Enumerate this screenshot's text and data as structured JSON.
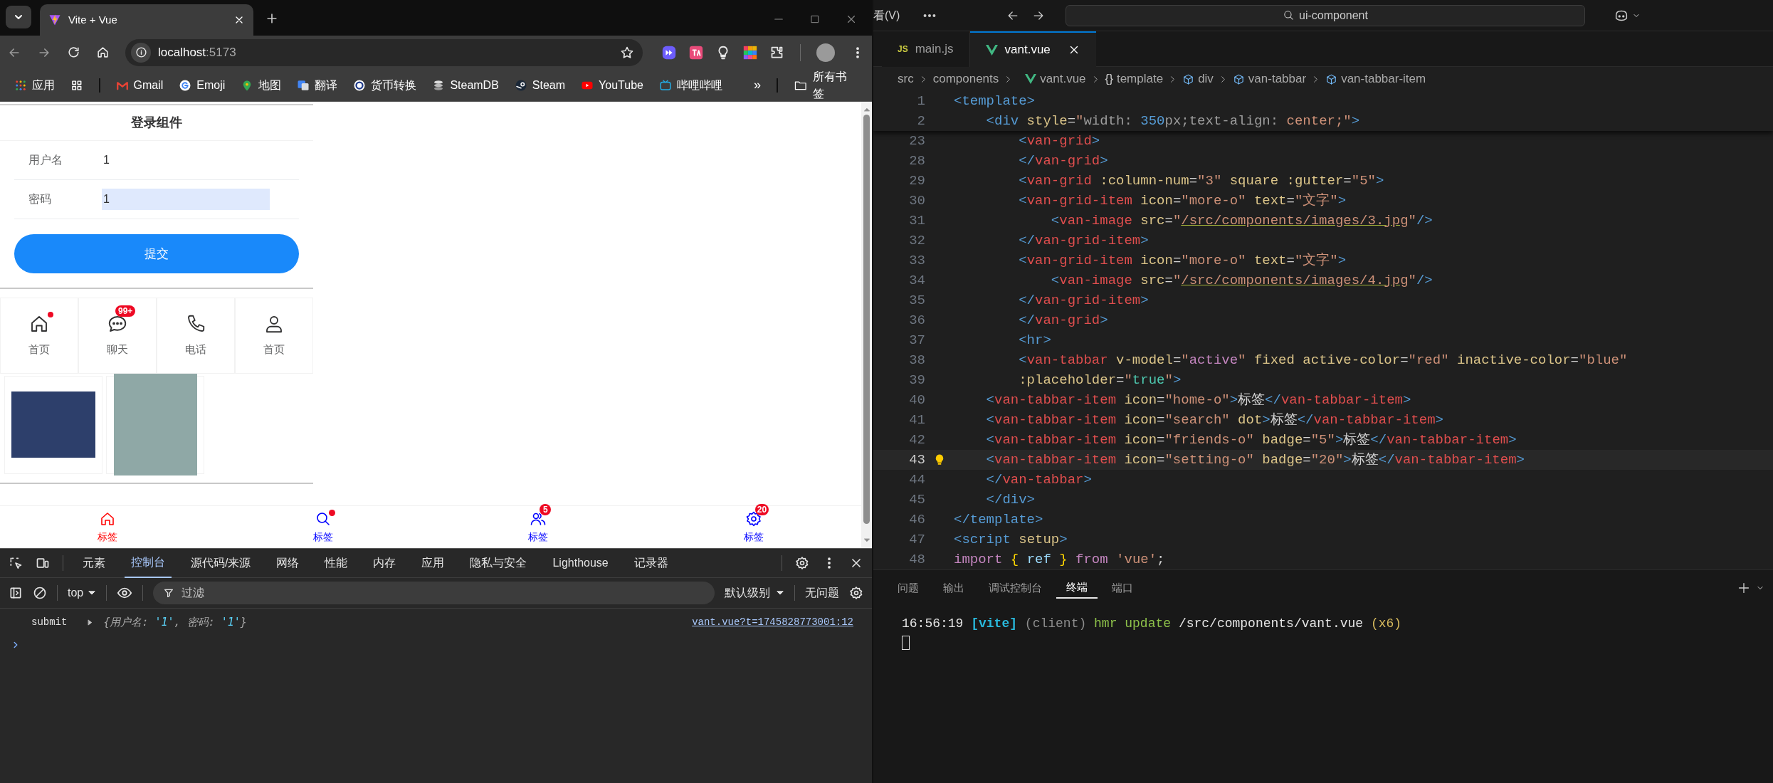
{
  "browser": {
    "tab": {
      "title": "Vite + Vue"
    },
    "address": {
      "host": "localhost",
      "port": ":5173"
    },
    "bookmarks": [
      {
        "label": "应用",
        "kind": "apps"
      },
      {
        "label": "Gmail",
        "kind": "gmail"
      },
      {
        "label": "Emoji",
        "kind": "google"
      },
      {
        "label": "地图",
        "kind": "maps"
      },
      {
        "label": "翻译",
        "kind": "translate"
      },
      {
        "label": "货币转换",
        "kind": "xe"
      },
      {
        "label": "SteamDB",
        "kind": "steamdb"
      },
      {
        "label": "Steam",
        "kind": "steam"
      },
      {
        "label": "YouTube",
        "kind": "youtube"
      },
      {
        "label": "哔哩哔哩",
        "kind": "bilibili"
      }
    ],
    "bookmarks_more": "»",
    "all_bookmarks": "所有书签"
  },
  "page": {
    "form": {
      "title": "登录组件",
      "fields": [
        {
          "label": "用户名",
          "value": "1",
          "autofilled": false
        },
        {
          "label": "密码",
          "value": "1",
          "autofilled": true
        }
      ],
      "submit": "提交"
    },
    "grid": [
      {
        "label": "首页",
        "kind": "home",
        "dot": true
      },
      {
        "label": "聊天",
        "kind": "chat",
        "dot": false,
        "badge": "99+"
      },
      {
        "label": "电话",
        "kind": "phone",
        "dot": false
      },
      {
        "label": "首页",
        "kind": "user",
        "dot": false
      }
    ],
    "images": [
      {
        "kind": "landscape"
      },
      {
        "kind": "portrait"
      }
    ],
    "tabbar": [
      {
        "label": "标签",
        "kind": "home",
        "selected": true,
        "dot": false
      },
      {
        "label": "标签",
        "kind": "search",
        "selected": false,
        "dot": true
      },
      {
        "label": "标签",
        "kind": "friends",
        "selected": false,
        "dot": false,
        "badge": "5"
      },
      {
        "label": "标签",
        "kind": "gear",
        "selected": false,
        "dot": false,
        "badge": "20"
      }
    ]
  },
  "devtools": {
    "tabs": [
      {
        "label": "元素",
        "selected": false
      },
      {
        "label": "控制台",
        "selected": true
      },
      {
        "label": "源代码/来源",
        "selected": false
      },
      {
        "label": "网络",
        "selected": false
      },
      {
        "label": "性能",
        "selected": false
      },
      {
        "label": "内存",
        "selected": false
      },
      {
        "label": "应用",
        "selected": false
      },
      {
        "label": "隐私与安全",
        "selected": false
      },
      {
        "label": "Lighthouse",
        "selected": false
      },
      {
        "label": "记录器",
        "selected": false
      }
    ],
    "console_toolbar": {
      "context": "top",
      "filter_placeholder": "过滤",
      "level": "默认级别",
      "issues": "无问题"
    },
    "log": [
      {
        "message": "submit",
        "object": [
          {
            "kind": "punct",
            "text": "{用户名: "
          },
          {
            "kind": "value",
            "text": "'1'"
          },
          {
            "kind": "punct",
            "text": ", 密码: "
          },
          {
            "kind": "value",
            "text": "'1'"
          },
          {
            "kind": "punct",
            "text": "}"
          }
        ],
        "source": "vant.vue?t=1745828773001:12"
      }
    ]
  },
  "editor": {
    "menu": "看(V)",
    "search": "ui-component",
    "tabs": [
      {
        "label": "main.js",
        "kind": "js",
        "badge": "JS",
        "selected": false
      },
      {
        "label": "vant.vue",
        "kind": "vue",
        "selected": true
      }
    ],
    "breadcrumb": [
      {
        "label": "src",
        "kind": "folder"
      },
      {
        "label": "components",
        "kind": "folder"
      },
      {
        "label": "vant.vue",
        "kind": "vue"
      },
      {
        "label": "template",
        "kind": "braces",
        "symbol": "{}"
      },
      {
        "label": "div",
        "kind": "element"
      },
      {
        "label": "van-tabbar",
        "kind": "element"
      },
      {
        "label": "van-tabbar-item",
        "kind": "element"
      }
    ],
    "sticky_lines": [
      {
        "number": "1",
        "current": false,
        "tokens": [
          {
            "kind": "tag",
            "text": "<template>"
          }
        ]
      },
      {
        "number": "2",
        "current": false,
        "tokens": [
          {
            "kind": "tag",
            "text": "    <div"
          },
          {
            "kind": "attr",
            "text": " style"
          },
          {
            "kind": "text",
            "text": "="
          },
          {
            "kind": "str",
            "text": "\""
          },
          {
            "kind": "css",
            "text": "width: "
          },
          {
            "kind": "num",
            "text": "350"
          },
          {
            "kind": "css",
            "text": "px;text-align: "
          },
          {
            "kind": "str",
            "text": "center;\""
          },
          {
            "kind": "tag",
            "text": ">"
          }
        ]
      }
    ],
    "lines": [
      {
        "number": "23",
        "current": false,
        "tokens": [
          {
            "kind": "tag",
            "text": "        <"
          },
          {
            "kind": "comp",
            "text": "van-grid"
          },
          {
            "kind": "tag",
            "text": ">"
          }
        ]
      },
      {
        "number": "28",
        "current": false,
        "tokens": [
          {
            "kind": "tag",
            "text": "        </"
          },
          {
            "kind": "comp",
            "text": "van-grid"
          },
          {
            "kind": "tag",
            "text": ">"
          }
        ]
      },
      {
        "number": "29",
        "current": false,
        "tokens": [
          {
            "kind": "tag",
            "text": "        <"
          },
          {
            "kind": "comp",
            "text": "van-grid"
          },
          {
            "kind": "attr",
            "text": " :column-num"
          },
          {
            "kind": "text",
            "text": "="
          },
          {
            "kind": "str",
            "text": "\"3\""
          },
          {
            "kind": "attr",
            "text": " square :gutter"
          },
          {
            "kind": "text",
            "text": "="
          },
          {
            "kind": "str",
            "text": "\"5\""
          },
          {
            "kind": "tag",
            "text": ">"
          }
        ]
      },
      {
        "number": "30",
        "current": false,
        "tokens": [
          {
            "kind": "tag",
            "text": "        <"
          },
          {
            "kind": "comp",
            "text": "van-grid-item"
          },
          {
            "kind": "attr",
            "text": " icon"
          },
          {
            "kind": "text",
            "text": "="
          },
          {
            "kind": "str",
            "text": "\"more-o\""
          },
          {
            "kind": "attr",
            "text": " text"
          },
          {
            "kind": "text",
            "text": "="
          },
          {
            "kind": "str",
            "text": "\"文字\""
          },
          {
            "kind": "tag",
            "text": ">"
          }
        ]
      },
      {
        "number": "31",
        "current": false,
        "tokens": [
          {
            "kind": "tag",
            "text": "            <"
          },
          {
            "kind": "comp",
            "text": "van-image"
          },
          {
            "kind": "attr",
            "text": " src"
          },
          {
            "kind": "text",
            "text": "="
          },
          {
            "kind": "str",
            "text": "\""
          },
          {
            "kind": "link",
            "text": "/src/components/images/3.jpg"
          },
          {
            "kind": "str",
            "text": "\""
          },
          {
            "kind": "tag",
            "text": "/>"
          }
        ]
      },
      {
        "number": "32",
        "current": false,
        "tokens": [
          {
            "kind": "tag",
            "text": "        </"
          },
          {
            "kind": "comp",
            "text": "van-grid-item"
          },
          {
            "kind": "tag",
            "text": ">"
          }
        ]
      },
      {
        "number": "33",
        "current": false,
        "tokens": [
          {
            "kind": "tag",
            "text": "        <"
          },
          {
            "kind": "comp",
            "text": "van-grid-item"
          },
          {
            "kind": "attr",
            "text": " icon"
          },
          {
            "kind": "text",
            "text": "="
          },
          {
            "kind": "str",
            "text": "\"more-o\""
          },
          {
            "kind": "attr",
            "text": " text"
          },
          {
            "kind": "text",
            "text": "="
          },
          {
            "kind": "str",
            "text": "\"文字\""
          },
          {
            "kind": "tag",
            "text": ">"
          }
        ]
      },
      {
        "number": "34",
        "current": false,
        "tokens": [
          {
            "kind": "tag",
            "text": "            <"
          },
          {
            "kind": "comp",
            "text": "van-image"
          },
          {
            "kind": "attr",
            "text": " src"
          },
          {
            "kind": "text",
            "text": "="
          },
          {
            "kind": "str",
            "text": "\""
          },
          {
            "kind": "link",
            "text": "/src/components/images/4.jpg"
          },
          {
            "kind": "str",
            "text": "\""
          },
          {
            "kind": "tag",
            "text": "/>"
          }
        ]
      },
      {
        "number": "35",
        "current": false,
        "tokens": [
          {
            "kind": "tag",
            "text": "        </"
          },
          {
            "kind": "comp",
            "text": "van-grid-item"
          },
          {
            "kind": "tag",
            "text": ">"
          }
        ]
      },
      {
        "number": "36",
        "current": false,
        "tokens": [
          {
            "kind": "tag",
            "text": "        </"
          },
          {
            "kind": "comp",
            "text": "van-grid"
          },
          {
            "kind": "tag",
            "text": ">"
          }
        ]
      },
      {
        "number": "37",
        "current": false,
        "tokens": [
          {
            "kind": "tag",
            "text": "        <hr>"
          }
        ]
      },
      {
        "number": "38",
        "current": false,
        "tokens": [
          {
            "kind": "tag",
            "text": "        <"
          },
          {
            "kind": "comp",
            "text": "van-tabbar"
          },
          {
            "kind": "attr",
            "text": " v-model"
          },
          {
            "kind": "text",
            "text": "="
          },
          {
            "kind": "str",
            "text": "\""
          },
          {
            "kind": "var",
            "text": "active"
          },
          {
            "kind": "str",
            "text": "\""
          },
          {
            "kind": "attr",
            "text": " fixed active-color"
          },
          {
            "kind": "text",
            "text": "="
          },
          {
            "kind": "str",
            "text": "\"red\""
          },
          {
            "kind": "attr",
            "text": " inactive-color"
          },
          {
            "kind": "text",
            "text": "="
          },
          {
            "kind": "str",
            "text": "\"blue\""
          }
        ]
      },
      {
        "number": "39",
        "current": false,
        "tokens": [
          {
            "kind": "attr",
            "text": "        :placeholder"
          },
          {
            "kind": "text",
            "text": "="
          },
          {
            "kind": "str",
            "text": "\""
          },
          {
            "kind": "const",
            "text": "true"
          },
          {
            "kind": "str",
            "text": "\""
          },
          {
            "kind": "tag",
            "text": ">"
          }
        ]
      },
      {
        "number": "40",
        "current": false,
        "tokens": [
          {
            "kind": "tag",
            "text": "    <"
          },
          {
            "kind": "comp",
            "text": "van-tabbar-item"
          },
          {
            "kind": "attr",
            "text": " icon"
          },
          {
            "kind": "text",
            "text": "="
          },
          {
            "kind": "str",
            "text": "\"home-o\""
          },
          {
            "kind": "tag",
            "text": ">"
          },
          {
            "kind": "text",
            "text": "标签"
          },
          {
            "kind": "tag",
            "text": "</"
          },
          {
            "kind": "comp",
            "text": "van-tabbar-item"
          },
          {
            "kind": "tag",
            "text": ">"
          }
        ]
      },
      {
        "number": "41",
        "current": false,
        "tokens": [
          {
            "kind": "tag",
            "text": "    <"
          },
          {
            "kind": "comp",
            "text": "van-tabbar-item"
          },
          {
            "kind": "attr",
            "text": " icon"
          },
          {
            "kind": "text",
            "text": "="
          },
          {
            "kind": "str",
            "text": "\"search\""
          },
          {
            "kind": "attr",
            "text": " dot"
          },
          {
            "kind": "tag",
            "text": ">"
          },
          {
            "kind": "text",
            "text": "标签"
          },
          {
            "kind": "tag",
            "text": "</"
          },
          {
            "kind": "comp",
            "text": "van-tabbar-item"
          },
          {
            "kind": "tag",
            "text": ">"
          }
        ]
      },
      {
        "number": "42",
        "current": false,
        "tokens": [
          {
            "kind": "tag",
            "text": "    <"
          },
          {
            "kind": "comp",
            "text": "van-tabbar-item"
          },
          {
            "kind": "attr",
            "text": " icon"
          },
          {
            "kind": "text",
            "text": "="
          },
          {
            "kind": "str",
            "text": "\"friends-o\""
          },
          {
            "kind": "attr",
            "text": " badge"
          },
          {
            "kind": "text",
            "text": "="
          },
          {
            "kind": "str",
            "text": "\"5\""
          },
          {
            "kind": "tag",
            "text": ">"
          },
          {
            "kind": "text",
            "text": "标签"
          },
          {
            "kind": "tag",
            "text": "</"
          },
          {
            "kind": "comp",
            "text": "van-tabbar-item"
          },
          {
            "kind": "tag",
            "text": ">"
          }
        ]
      },
      {
        "number": "43",
        "current": true,
        "tokens": [
          {
            "kind": "tag",
            "text": "    <"
          },
          {
            "kind": "comp",
            "text": "van-tabbar-item"
          },
          {
            "kind": "attr",
            "text": " icon"
          },
          {
            "kind": "text",
            "text": "="
          },
          {
            "kind": "str",
            "text": "\"setting-o\""
          },
          {
            "kind": "attr",
            "text": " badge"
          },
          {
            "kind": "text",
            "text": "="
          },
          {
            "kind": "str",
            "text": "\"20\""
          },
          {
            "kind": "tag",
            "text": ">"
          },
          {
            "kind": "text",
            "text": "标签"
          },
          {
            "kind": "tag",
            "text": "</"
          },
          {
            "kind": "comp",
            "text": "van-tabbar-item"
          },
          {
            "kind": "tag",
            "text": ">"
          }
        ]
      },
      {
        "number": "44",
        "current": false,
        "tokens": [
          {
            "kind": "tag",
            "text": "    </"
          },
          {
            "kind": "comp",
            "text": "van-tabbar"
          },
          {
            "kind": "tag",
            "text": ">"
          }
        ]
      },
      {
        "number": "45",
        "current": false,
        "tokens": [
          {
            "kind": "tag",
            "text": "    </div>"
          }
        ]
      },
      {
        "number": "46",
        "current": false,
        "tokens": [
          {
            "kind": "tag",
            "text": "</template>"
          }
        ]
      },
      {
        "number": "47",
        "current": false,
        "tokens": [
          {
            "kind": "tag",
            "text": "<script"
          },
          {
            "kind": "attr",
            "text": " setup"
          },
          {
            "kind": "tag",
            "text": ">"
          }
        ]
      },
      {
        "number": "48",
        "current": false,
        "tokens": [
          {
            "kind": "kw",
            "text": "import "
          },
          {
            "kind": "brace",
            "text": "{"
          },
          {
            "kind": "ident",
            "text": " ref "
          },
          {
            "kind": "brace",
            "text": "}"
          },
          {
            "kind": "kw",
            "text": " from "
          },
          {
            "kind": "str",
            "text": "'vue'"
          },
          {
            "kind": "text",
            "text": ";"
          }
        ]
      }
    ]
  },
  "panel": {
    "tabs": [
      {
        "label": "问题",
        "selected": false
      },
      {
        "label": "输出",
        "selected": false
      },
      {
        "label": "调试控制台",
        "selected": false
      },
      {
        "label": "终端",
        "selected": true
      },
      {
        "label": "端口",
        "selected": false
      }
    ],
    "terminal": [
      {
        "tokens": [
          {
            "kind": "time",
            "text": "16:56:19 "
          },
          {
            "kind": "vite",
            "text": "[vite]"
          },
          {
            "kind": "dim",
            "text": " (client)"
          },
          {
            "kind": "green",
            "text": " hmr update"
          },
          {
            "kind": "plain",
            "text": " /src/components/vant.vue"
          },
          {
            "kind": "yellow",
            "text": " (x6)"
          }
        ]
      }
    ]
  }
}
